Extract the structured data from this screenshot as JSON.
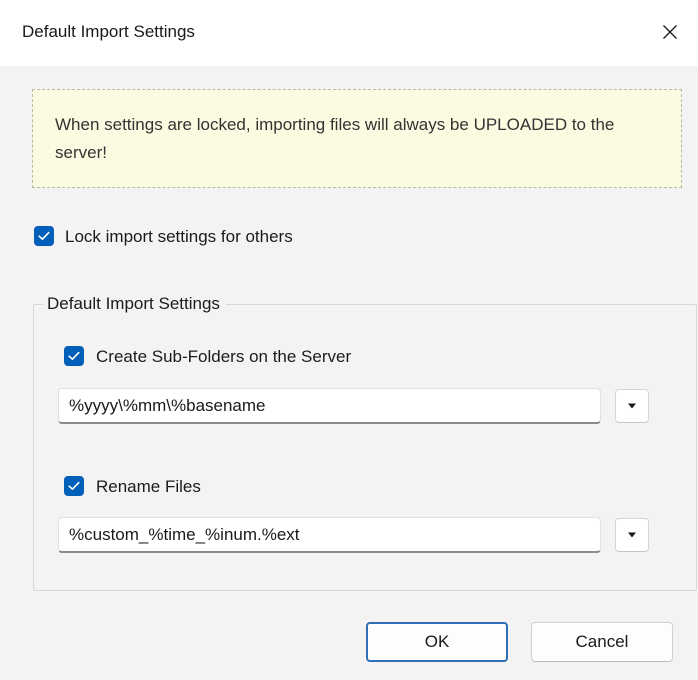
{
  "window": {
    "title": "Default Import Settings",
    "close_icon": "close-icon"
  },
  "notice": {
    "text": "When settings are locked, importing files will always be UPLOADED to the server!",
    "background_color": "#fbfbe1"
  },
  "lock": {
    "label": "Lock import settings for others",
    "checked": true
  },
  "group": {
    "legend": "Default Import Settings",
    "subfolders": {
      "label": "Create Sub-Folders on the Server",
      "checked": true,
      "value": "%yyyy\\%mm\\%basename"
    },
    "rename": {
      "label": "Rename Files",
      "checked": true,
      "value": "%custom_%time_%inum.%ext"
    }
  },
  "buttons": {
    "ok": "OK",
    "cancel": "Cancel"
  },
  "colors": {
    "accent": "#005fb8",
    "default_button_border": "#2f6fb5"
  }
}
